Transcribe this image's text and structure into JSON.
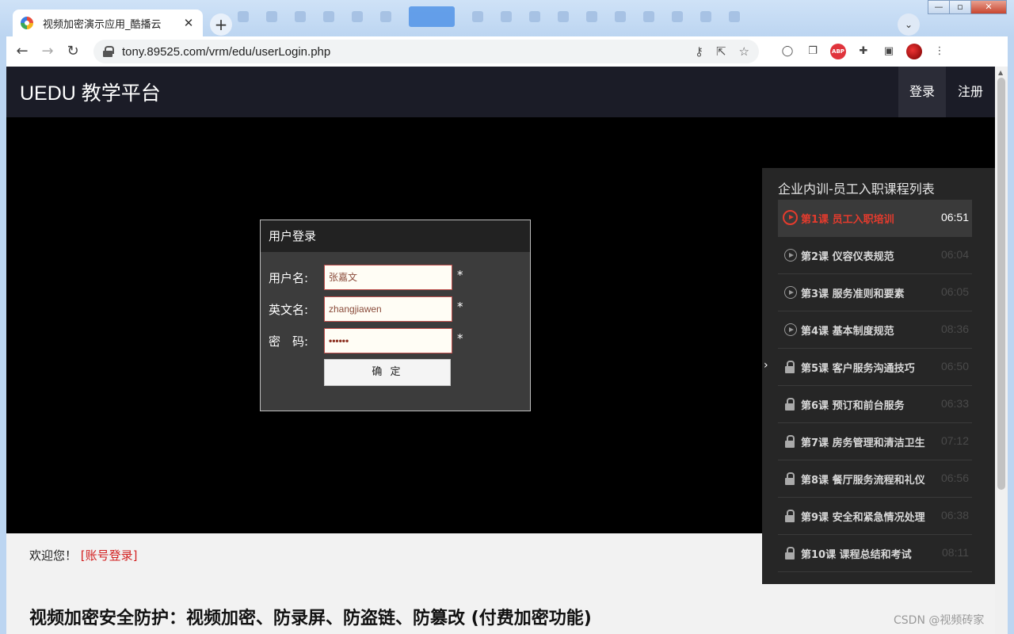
{
  "browser": {
    "tab_title": "视频加密演示应用_酷播云",
    "tab_close": "✕",
    "new_tab": "+",
    "url": "tony.89525.com/vrm/edu/userLogin.php",
    "window_controls": {
      "minimize": "—",
      "maximize": "▫",
      "close": "✕"
    }
  },
  "site": {
    "brand": "UEDU 教学平台",
    "nav": {
      "login": "登录",
      "register": "注册"
    }
  },
  "login_dialog": {
    "title": "用户登录",
    "username_label": "用户名:",
    "username_value": "张嘉文",
    "english_label": "英文名:",
    "english_value": "zhangjiawen",
    "password_label": "密　码:",
    "password_value": "••••••",
    "required_mark": "*",
    "submit_label": "确 定"
  },
  "course_list": {
    "heading": "企业内训-员工入职课程列表",
    "items": [
      {
        "title": "第1课 员工入职培训",
        "duration": "06:51",
        "state": "playing"
      },
      {
        "title": "第2课 仪容仪表规范",
        "duration": "06:04",
        "state": "unlocked"
      },
      {
        "title": "第3课 服务准则和要素",
        "duration": "06:05",
        "state": "unlocked"
      },
      {
        "title": "第4课 基本制度规范",
        "duration": "08:36",
        "state": "unlocked"
      },
      {
        "title": "第5课 客户服务沟通技巧",
        "duration": "06:50",
        "state": "locked"
      },
      {
        "title": "第6课 预订和前台服务",
        "duration": "06:33",
        "state": "locked"
      },
      {
        "title": "第7课 房务管理和清洁卫生",
        "duration": "07:12",
        "state": "locked"
      },
      {
        "title": "第8课 餐厅服务流程和礼仪",
        "duration": "06:56",
        "state": "locked"
      },
      {
        "title": "第9课 安全和紧急情况处理",
        "duration": "06:38",
        "state": "locked"
      },
      {
        "title": "第10课 课程总结和考试",
        "duration": "08:11",
        "state": "locked"
      }
    ]
  },
  "footer": {
    "welcome_text": "欢迎您！",
    "welcome_link": "[账号登录]",
    "headline": "视频加密安全防护：视频加密、防录屏、防盗链、防篡改 (付费加密功能)",
    "watermark": "CSDN @视频砖家"
  }
}
